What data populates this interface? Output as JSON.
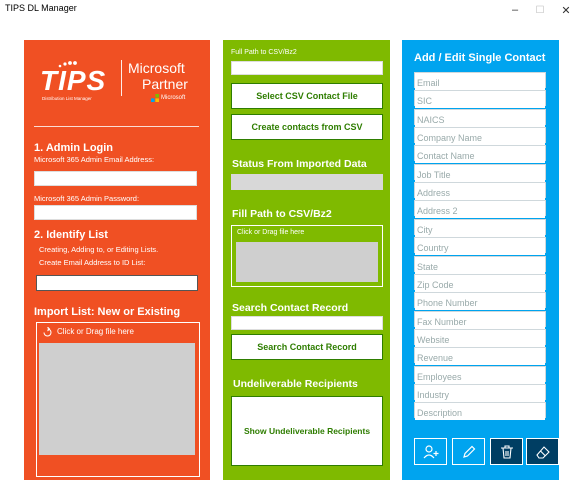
{
  "window": {
    "title": "TIPS DL Manager",
    "controls": {
      "minimize": "–",
      "maximize": "☐",
      "close": "✕"
    }
  },
  "logo": {
    "tips": "TIPS",
    "subtitle": "Distribution List Manager",
    "partner_line1": "Microsoft",
    "partner_line2": "Partner",
    "microsoft": "Microsoft"
  },
  "left": {
    "admin_heading": "1. Admin Login",
    "email_label": "Microsoft 365 Admin Email Address:",
    "password_label": "Microsoft 365 Admin Password:",
    "identify_heading": "2. Identify List",
    "identify_desc": "Creating, Adding to, or Editing Lists.",
    "create_desc": "Create Email Address to ID List:",
    "import_heading": "Import List: New or Existing",
    "drop_text": "Click or Drag file here"
  },
  "middle": {
    "path_label": "Full Path to CSV/Bz2",
    "select_button": "Select CSV Contact File",
    "create_button": "Create contacts from CSV",
    "status_heading": "Status From Imported Data",
    "fill_heading": "Fill Path to CSV/Bz2",
    "drop_text": "Click or Drag file here",
    "search_heading": "Search Contact Record",
    "search_button": "Search Contact Record",
    "undeliverable_heading": "Undeliverable Recipients",
    "undeliverable_button": "Show Undeliverable Recipients"
  },
  "right": {
    "heading": "Add / Edit Single Contact",
    "fields": [
      "Email",
      "SIC",
      "NAICS",
      "Company Name",
      "Contact Name",
      "Job Title",
      "Address",
      "Address 2",
      "City",
      "Country",
      "State",
      "Zip Code",
      "Phone Number",
      "Fax Number",
      "Website",
      "Revenue",
      "Employees",
      "Industry",
      "Description"
    ],
    "buttons": [
      "add-user-icon",
      "pencil-icon",
      "trash-icon",
      "eraser-icon"
    ]
  },
  "colors": {
    "orange": "#f05023",
    "green": "#7fba00",
    "blue": "#00a4ef",
    "yellow": "#ffb900"
  }
}
